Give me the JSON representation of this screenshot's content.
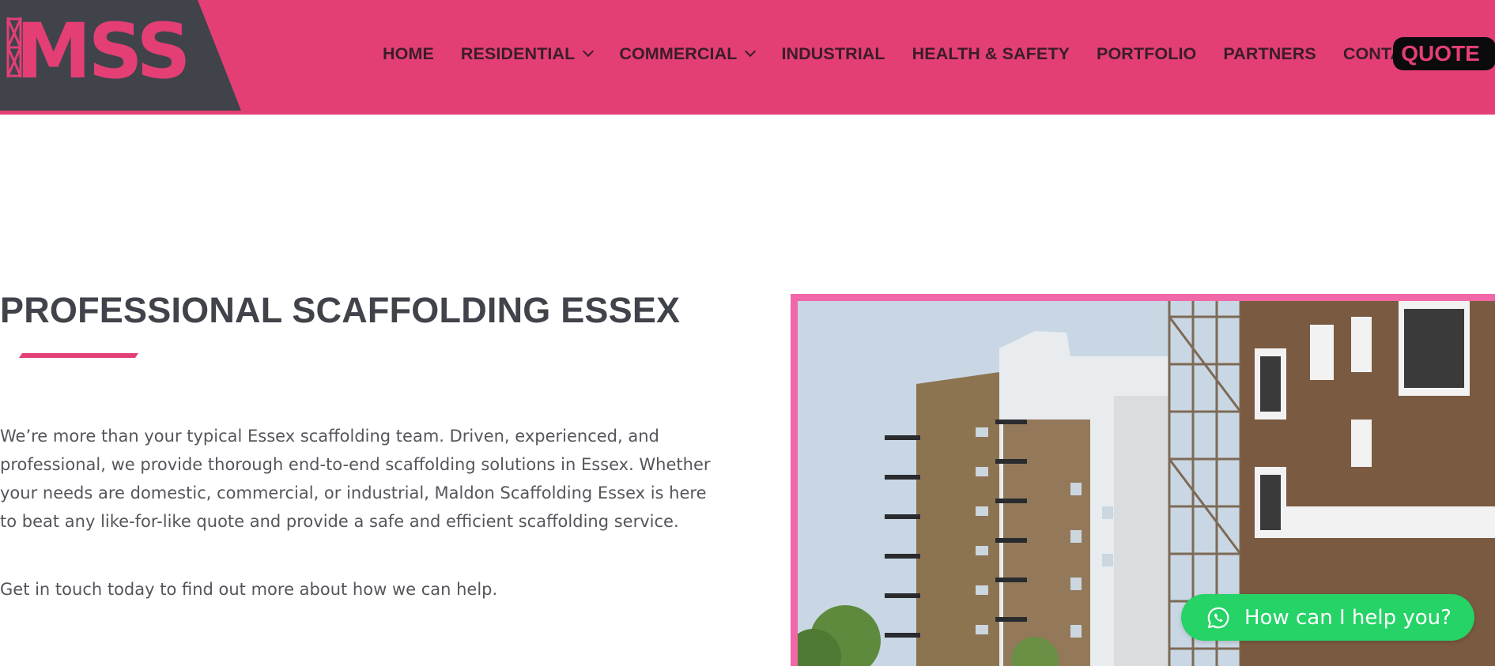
{
  "brand": {
    "logo_text": "MSS",
    "colors": {
      "primary": "#e33f75",
      "dark": "#41434b",
      "whatsapp": "#25d366",
      "frame": "#f168a8"
    }
  },
  "nav": {
    "items": [
      {
        "label": "HOME",
        "has_dropdown": false
      },
      {
        "label": "RESIDENTIAL",
        "has_dropdown": true
      },
      {
        "label": "COMMERCIAL",
        "has_dropdown": true
      },
      {
        "label": "INDUSTRIAL",
        "has_dropdown": false
      },
      {
        "label": "HEALTH & SAFETY",
        "has_dropdown": false
      },
      {
        "label": "PORTFOLIO",
        "has_dropdown": false
      },
      {
        "label": "PARTNERS",
        "has_dropdown": false
      },
      {
        "label": "CONTACT",
        "has_dropdown": false
      }
    ],
    "quote_label": "QUOTE",
    "dropdown_icon": "chevron-down-icon"
  },
  "main": {
    "title": "PROFESSIONAL SCAFFOLDING ESSEX",
    "paragraph1": "We’re more than your typical Essex scaffolding team. Driven, experienced, and professional, we provide thorough end-to-end scaffolding solutions in Essex. Whether your needs are domestic, commercial, or industrial, Maldon Scaffolding Essex is here to beat any like-for-like quote and provide a safe and efficient scaffolding service.",
    "paragraph2": "Get in touch today to find out more about how we can help.",
    "image_icon": "building-scaffolding-photo"
  },
  "chat": {
    "label": "How can I help you?",
    "icon": "whatsapp-icon"
  }
}
